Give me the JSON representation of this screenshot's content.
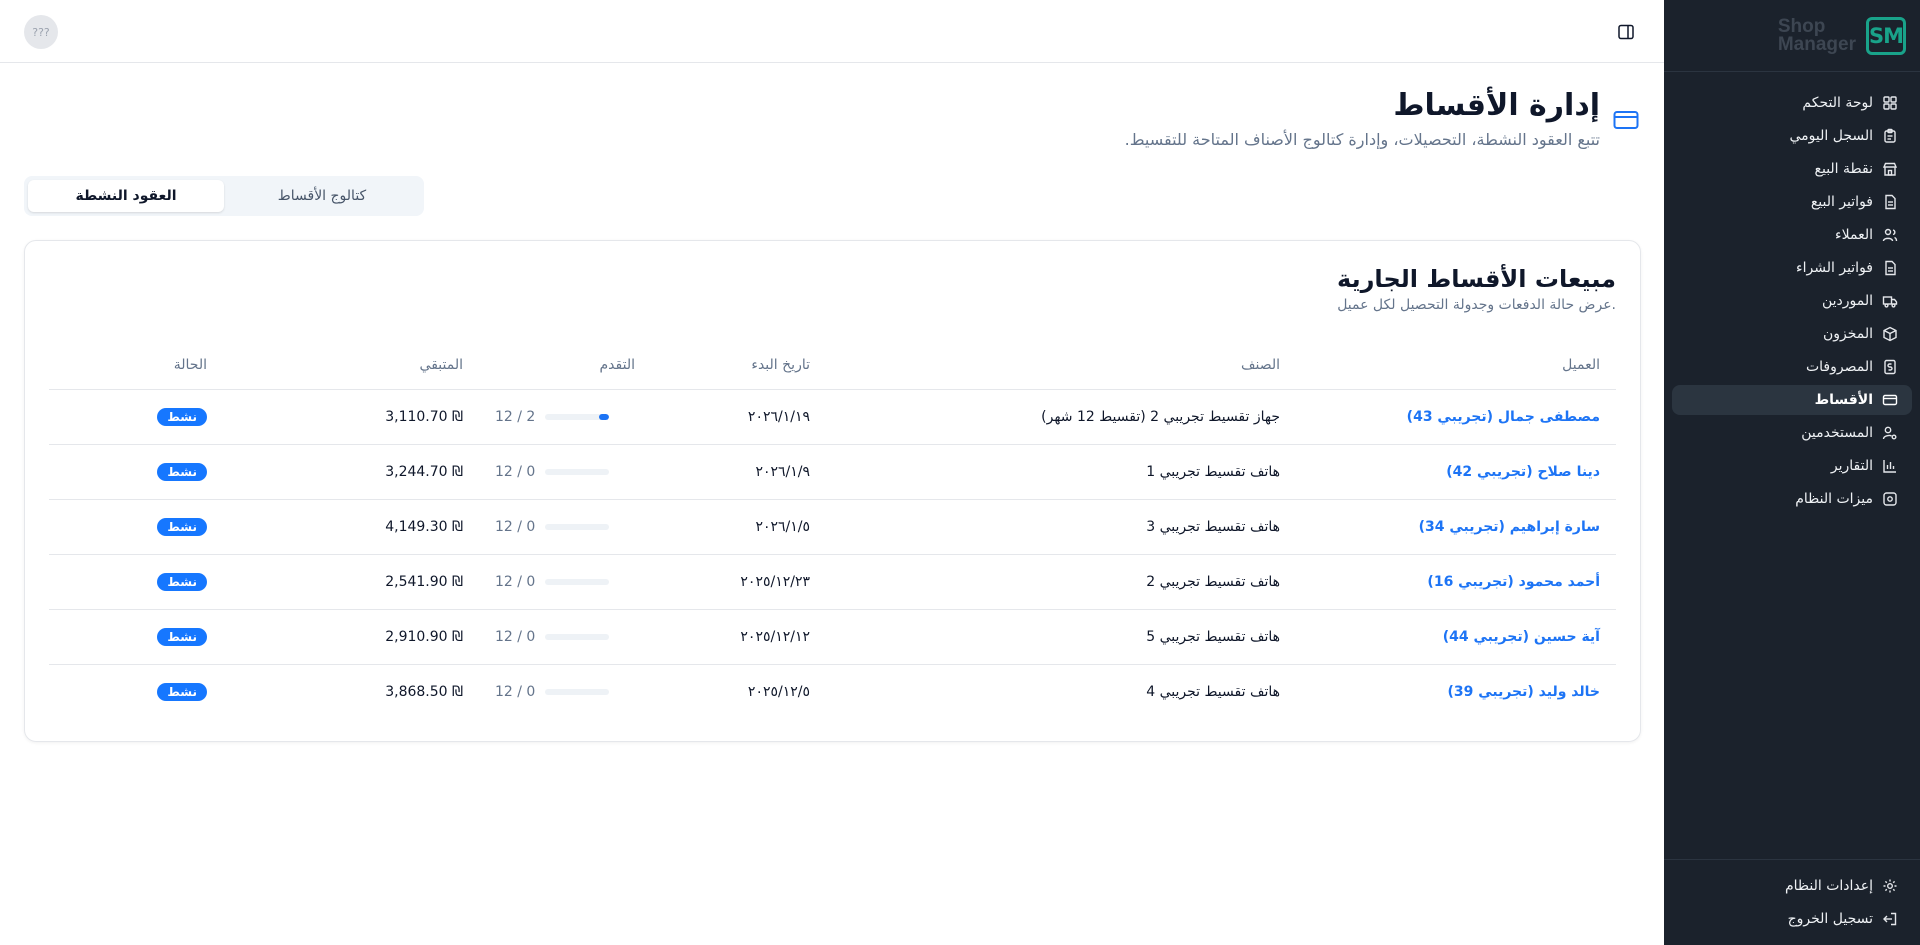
{
  "sidebar": {
    "logo_mark": "SM",
    "logo_line1": "Shop",
    "logo_line2": "Manager",
    "items": [
      {
        "label": "لوحة التحكم",
        "icon": "grid-icon"
      },
      {
        "label": "السجل اليومي",
        "icon": "clipboard-icon"
      },
      {
        "label": "نقطة البيع",
        "icon": "store-icon"
      },
      {
        "label": "فواتير البيع",
        "icon": "file-text-icon"
      },
      {
        "label": "العملاء",
        "icon": "users-icon"
      },
      {
        "label": "فواتير الشراء",
        "icon": "file-text-icon"
      },
      {
        "label": "الموردين",
        "icon": "truck-icon"
      },
      {
        "label": "المخزون",
        "icon": "package-icon"
      },
      {
        "label": "المصروفات",
        "icon": "receipt-icon"
      },
      {
        "label": "الأقساط",
        "icon": "credit-card-icon"
      },
      {
        "label": "المستخدمين",
        "icon": "user-cog-icon"
      },
      {
        "label": "التقارير",
        "icon": "bar-chart-icon"
      },
      {
        "label": "ميزات النظام",
        "icon": "settings-icon"
      }
    ],
    "active_index": 9,
    "settings_label": "إعدادات النظام",
    "logout_label": "تسجيل الخروج"
  },
  "topbar": {
    "avatar_text": "???"
  },
  "header": {
    "title": "إدارة الأقساط",
    "subtitle": "تتبع العقود النشطة، التحصيلات، وإدارة كتالوج الأصناف المتاحة للتقسيط."
  },
  "tabs": {
    "active": "العقود النشطة",
    "catalog": "كتالوج الأقساط"
  },
  "card": {
    "title": "مبيعات الأقساط الجارية",
    "subtitle": ".عرض حالة الدفعات وجدولة التحصيل لكل عميل"
  },
  "table": {
    "headers": {
      "customer": "العميل",
      "item": "الصنف",
      "start_date": "تاريخ البدء",
      "progress": "التقدم",
      "remaining": "المتبقي",
      "status": "الحالة"
    },
    "rows": [
      {
        "customer": "مصطفى جمال (تجريبي 43)",
        "item": "جهاز تقسيط تجريبي 2 (تقسيط 12 شهر)",
        "start_date": "٢٠٢٦/١/١٩",
        "progress_text": "12 / 2",
        "paid": 2,
        "total": 12,
        "remaining": "3,110.70 ₪",
        "status": "نشط"
      },
      {
        "customer": "دينا صلاح (تجريبي 42)",
        "item": "هاتف تقسيط تجريبي 1",
        "start_date": "٢٠٢٦/١/٩",
        "progress_text": "12 / 0",
        "paid": 0,
        "total": 12,
        "remaining": "3,244.70 ₪",
        "status": "نشط"
      },
      {
        "customer": "سارة إبراهيم (تجريبي 34)",
        "item": "هاتف تقسيط تجريبي 3",
        "start_date": "٢٠٢٦/١/٥",
        "progress_text": "12 / 0",
        "paid": 0,
        "total": 12,
        "remaining": "4,149.30 ₪",
        "status": "نشط"
      },
      {
        "customer": "أحمد محمود (تجريبي 16)",
        "item": "هاتف تقسيط تجريبي 2",
        "start_date": "٢٠٢٥/١٢/٢٣",
        "progress_text": "12 / 0",
        "paid": 0,
        "total": 12,
        "remaining": "2,541.90 ₪",
        "status": "نشط"
      },
      {
        "customer": "آية حسين (تجريبي 44)",
        "item": "هاتف تقسيط تجريبي 5",
        "start_date": "٢٠٢٥/١٢/١٢",
        "progress_text": "12 / 0",
        "paid": 0,
        "total": 12,
        "remaining": "2,910.90 ₪",
        "status": "نشط"
      },
      {
        "customer": "خالد وليد (تجريبي 39)",
        "item": "هاتف تقسيط تجريبي 4",
        "start_date": "٢٠٢٥/١٢/٥",
        "progress_text": "12 / 0",
        "paid": 0,
        "total": 12,
        "remaining": "3,868.50 ₪",
        "status": "نشط"
      }
    ]
  },
  "colors": {
    "sidebar_bg": "#1b222c",
    "accent": "#1d74f5",
    "logo": "#19a38a"
  }
}
